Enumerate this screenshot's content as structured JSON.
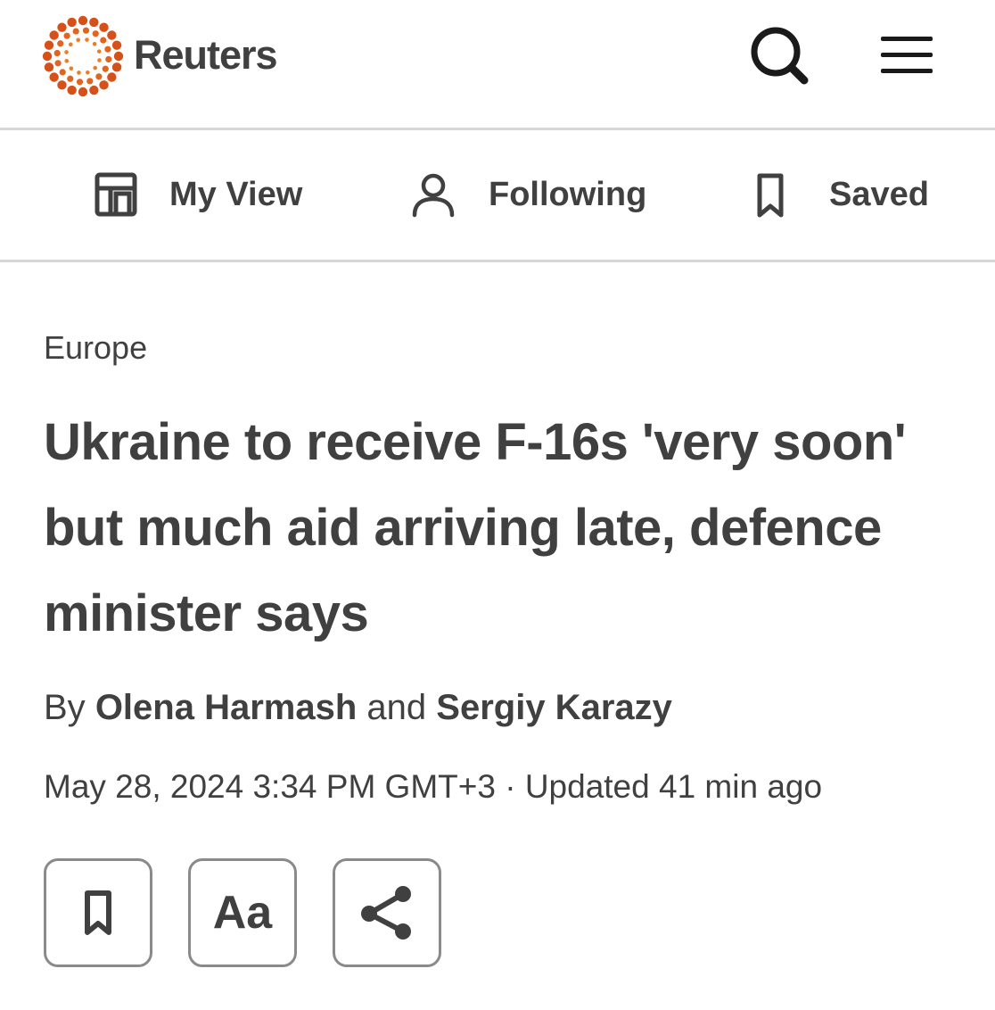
{
  "header": {
    "brand_name": "Reuters",
    "brand_color": "#ff8000"
  },
  "nav": {
    "items": [
      {
        "label": "My View",
        "icon": "layout-icon"
      },
      {
        "label": "Following",
        "icon": "person-icon"
      },
      {
        "label": "Saved",
        "icon": "bookmark-icon"
      }
    ]
  },
  "article": {
    "section": "Europe",
    "headline": "Ukraine to receive F-16s 'very soon' but much aid arriving late, defence minister says",
    "byline": {
      "prefix": "By",
      "author_1": "Olena Harmash",
      "conjunction": "and",
      "author_2": "Sergiy Karazy"
    },
    "dateline": "May 28, 2024 3:34 PM GMT+3 · Updated 41 min ago"
  },
  "actions": {
    "bookmark_icon": "bookmark-icon",
    "font_label": "Aa",
    "share_icon": "share-icon"
  }
}
